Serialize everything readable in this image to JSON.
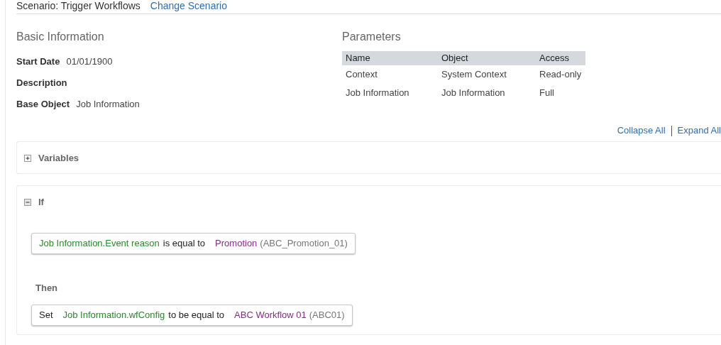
{
  "scenario": {
    "label": "Scenario: Trigger Workflows",
    "link": "Change Scenario"
  },
  "basic_information": {
    "title": "Basic Information",
    "fields": [
      {
        "label": "Start Date",
        "value": "01/01/1900"
      },
      {
        "label": "Description"
      },
      {
        "label": "Base Object",
        "value": "Job Information"
      }
    ]
  },
  "parameters": {
    "title": "Parameters",
    "columns": [
      "Name",
      "Object",
      "Access"
    ],
    "rows": [
      [
        "Context",
        "System Context",
        "Read-only"
      ],
      [
        "Job Information",
        "Job Information",
        "Full"
      ]
    ]
  },
  "toolbar": {
    "links": [
      "Collapse All",
      "Expand All"
    ]
  },
  "sections": [
    {
      "title": "Variables",
      "expanded": false
    },
    {
      "title": "If",
      "expanded": true,
      "condition": [
        {
          "kind": "field",
          "text": "Job Information.Event reason"
        },
        {
          "kind": "text",
          "text": "is equal to"
        },
        {
          "kind": "value",
          "text": "Promotion"
        },
        {
          "kind": "code",
          "text": "(ABC_Promotion_01)"
        }
      ],
      "then_label": "Then",
      "action": [
        {
          "kind": "text",
          "text": "Set"
        },
        {
          "kind": "field",
          "text": "Job Information.wfConfig"
        },
        {
          "kind": "text",
          "text": "to be equal to"
        },
        {
          "kind": "value",
          "text": "ABC Workflow 01"
        },
        {
          "kind": "code",
          "text": "(ABC01)"
        }
      ]
    }
  ]
}
